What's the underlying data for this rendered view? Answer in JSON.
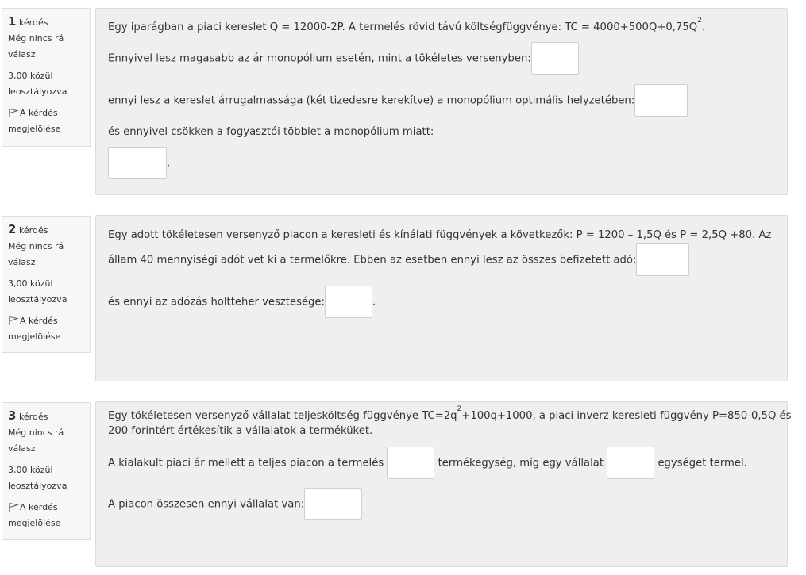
{
  "questions": [
    {
      "number": "1",
      "word": "kérdés",
      "state_a": "Még nincs rá",
      "state_b": "válasz",
      "grade_a": "3,00 közül",
      "grade_b": "leosztályozva",
      "flag_a": "A kérdés",
      "flag_b": "megjelölése",
      "text1": "Egy iparágban a piaci kereslet Q = 12000-2P. A termelés rövid távú költségfüggvénye: TC = 4000+500Q+0,75Q",
      "text1_sup": "2",
      "text1_end": ".",
      "text2": "Ennyivel lesz magasabb az ár monopólium esetén, mint a tökéletes versenyben:",
      "text3": "ennyi lesz a kereslet árrugalmassága (két tizedesre kerekítve) a monopólium optimális helyzetében:",
      "text4": "és ennyivel csökken a fogyasztói többlet a monopólium miatt:",
      "text5_end": "."
    },
    {
      "number": "2",
      "word": "kérdés",
      "state_a": "Még nincs rá",
      "state_b": "válasz",
      "grade_a": "3,00 közül",
      "grade_b": "leosztályozva",
      "flag_a": "A kérdés",
      "flag_b": "megjelölése",
      "text1": "Egy adott tökéletesen versenyző piacon a keresleti és kínálati függvények a következők: P = 1200 – 1,5Q és P = 2,5Q +80. Az",
      "text2": "állam 40 mennyiségi adót vet ki a termelőkre. Ebben az esetben ennyi lesz az összes befizetett adó:",
      "text3": "és ennyi az adózás holtteher vesztesége:",
      "text3_end": "."
    },
    {
      "number": "3",
      "word": "kérdés",
      "state_a": "Még nincs rá",
      "state_b": "válasz",
      "grade_a": "3,00 közül",
      "grade_b": "leosztályozva",
      "flag_a": "A kérdés",
      "flag_b": "megjelölése",
      "text1a": "Egy tökéletesen versenyző vállalat teljesköltség függvénye TC=2q",
      "text1_sup": "2",
      "text1b": "+100q+1000, a piaci inverz keresleti függvény P=850-0,5Q és",
      "text2": "200 forintért értékesítik a vállalatok a terméküket.",
      "text3a": "A kialakult piaci ár mellett a teljes piacon a termelés",
      "text3b": "termékegység, míg egy vállalat",
      "text3c": "egységet termel.",
      "text4": "A piacon összesen ennyi vállalat van:"
    }
  ],
  "inputs": {
    "q1_price_diff": "",
    "q1_elasticity": "",
    "q1_surplus_loss": "",
    "q2_tax_total": "",
    "q2_deadweight": "",
    "q3_market_qty": "",
    "q3_firm_qty": "",
    "q3_firm_count": ""
  },
  "colors": {
    "panel_bg": "#efefef",
    "info_bg": "#f7f7f7",
    "input_bg": "#ffffff"
  }
}
